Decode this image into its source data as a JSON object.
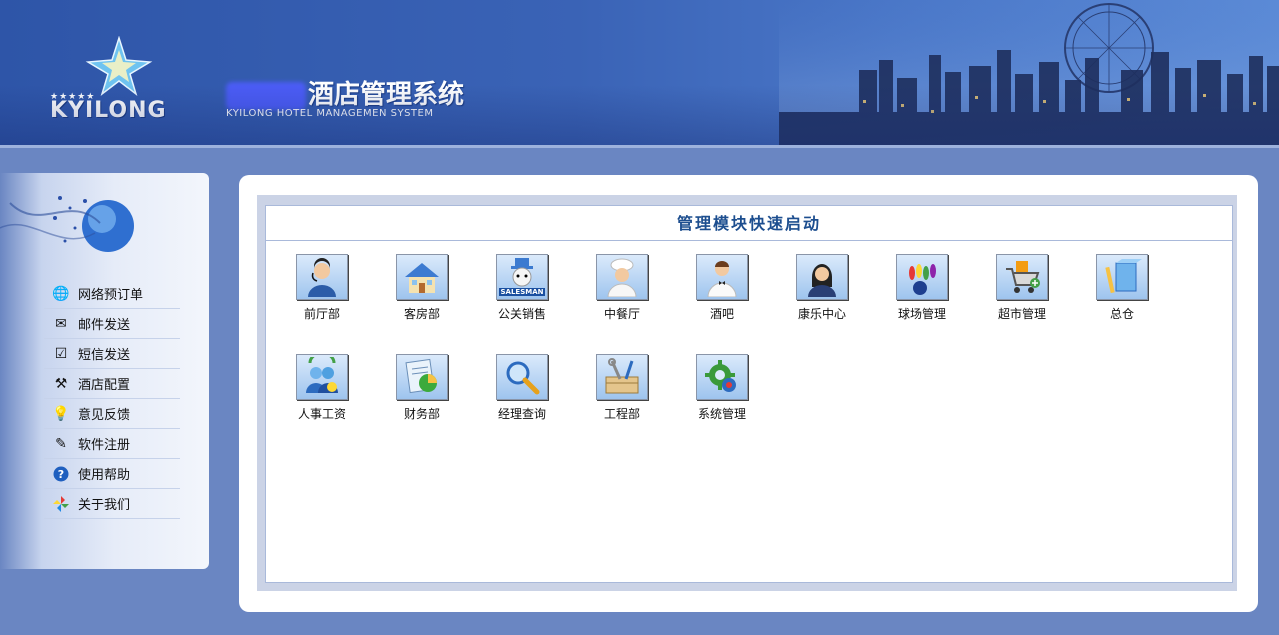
{
  "header": {
    "logo_stars": "★★★★★",
    "logo_text": "KYILONG",
    "title": "酒店管理系统",
    "subtitle": "KYILONG HOTEL MANAGEMEN SYSTEM"
  },
  "sidebar": {
    "items": [
      {
        "label": "网络预订单",
        "icon": "globe-icon"
      },
      {
        "label": "邮件发送",
        "icon": "envelope-icon"
      },
      {
        "label": "短信发送",
        "icon": "checkbox-icon"
      },
      {
        "label": "酒店配置",
        "icon": "tools-icon"
      },
      {
        "label": "意见反馈",
        "icon": "lightbulb-icon"
      },
      {
        "label": "软件注册",
        "icon": "pencil-note-icon"
      },
      {
        "label": "使用帮助",
        "icon": "help-icon"
      },
      {
        "label": "关于我们",
        "icon": "pinwheel-icon"
      }
    ]
  },
  "main": {
    "title": "管理模块快速启动",
    "modules": [
      {
        "label": "前厅部",
        "icon": "receptionist-icon"
      },
      {
        "label": "客房部",
        "icon": "house-icon"
      },
      {
        "label": "公关销售",
        "icon": "salesman-icon",
        "badge": "SALESMAN"
      },
      {
        "label": "中餐厅",
        "icon": "chef-icon"
      },
      {
        "label": "酒吧",
        "icon": "waiter-icon"
      },
      {
        "label": "康乐中心",
        "icon": "woman-icon"
      },
      {
        "label": "球场管理",
        "icon": "bowling-icon"
      },
      {
        "label": "超市管理",
        "icon": "shopping-cart-icon"
      },
      {
        "label": "总仓",
        "icon": "warehouse-icon"
      },
      {
        "label": "人事工资",
        "icon": "people-icon"
      },
      {
        "label": "财务部",
        "icon": "finance-chart-icon"
      },
      {
        "label": "经理查询",
        "icon": "magnifier-icon"
      },
      {
        "label": "工程部",
        "icon": "toolbox-icon"
      },
      {
        "label": "系统管理",
        "icon": "gear-icon"
      }
    ]
  },
  "colors": {
    "background": "#6a86c2",
    "header": "#3a63b6",
    "title_text": "#1d4e8f"
  }
}
